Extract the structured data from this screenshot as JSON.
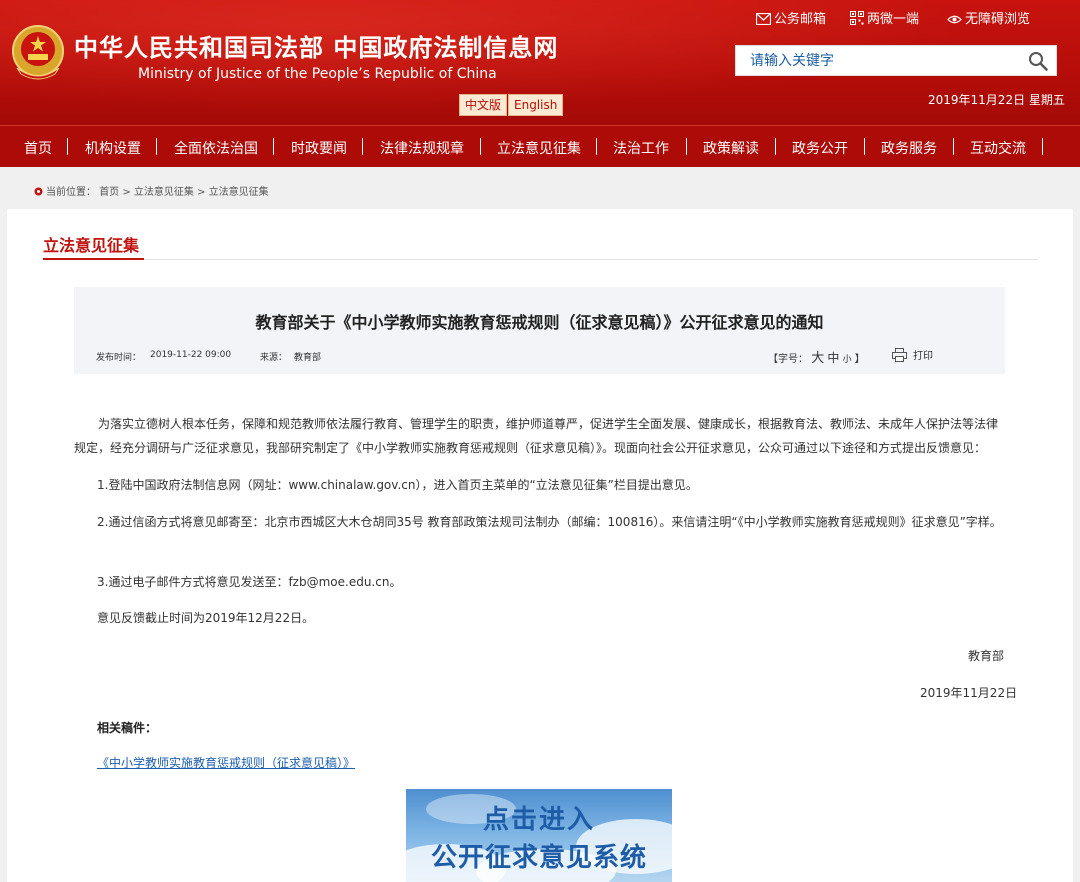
{
  "header": {
    "site_title_cn": "中华人民共和国司法部 中国政府法制信息网",
    "site_title_en": "Ministry of Justice of the People’s Republic of China",
    "lang_cn": "中文版",
    "lang_en": "English",
    "top_links": [
      "公务邮箱",
      "两微一端",
      "无障碍浏览"
    ],
    "search_placeholder": "请输入关键字",
    "date": "2019年11月22日 星期五",
    "brand_color": "#b50d09"
  },
  "nav": {
    "items": [
      "首页",
      "机构设置",
      "全面依法治国",
      "时政要闻",
      "法律法规规章",
      "立法意见征集",
      "法治工作",
      "政策解读",
      "政务公开",
      "政务服务",
      "互动交流"
    ]
  },
  "breadcrumb": {
    "label": "当前位置：",
    "path": "首页 > 立法意见征集 > 立法意见征集"
  },
  "section": {
    "title": "立法意见征集"
  },
  "article": {
    "title": "教育部关于《中小学教师实施教育惩戒规则（征求意见稿）》公开征求意见的通知",
    "publish_label": "发布时间：",
    "publish_time": "2019-11-22 09:00",
    "source_label": "来源：",
    "source": "教育部",
    "fontsize_label": "【字号：",
    "fontsize_big": "大",
    "fontsize_mid": "中",
    "fontsize_small": "小",
    "fontsize_end": "】",
    "print_label": "打印",
    "paragraphs": [
      "为落实立德树人根本任务，保障和规范教师依法履行教育、管理学生的职责，维护师道尊严，促进学生全面发展、健康成长，根据教育法、教师法、未成年人保护法等法律规定，经充分调研与广泛征求意见，我部研究制定了《中小学教师实施教育惩戒规则（征求意见稿）》。现面向社会公开征求意见，公众可通过以下途径和方式提出反馈意见：",
      "1.登陆中国政府法制信息网（网址：www.chinalaw.gov.cn），进入首页主菜单的“立法意见征集”栏目提出意见。",
      "2.通过信函方式将意见邮寄至：北京市西城区大木仓胡同35号 教育部政策法规司法制办（邮编：100816）。来信请注明“《中小学教师实施教育惩戒规则》征求意见”字样。",
      "3.通过电子邮件方式将意见发送至：fzb@moe.edu.cn。",
      "意见反馈截止时间为2019年12月22日。"
    ],
    "signature": "教育部",
    "sign_date": "2019年11月22日",
    "related_label": "相关稿件：",
    "related_link": "《中小学教师实施教育惩戒规则（征求意见稿）》"
  },
  "banner": {
    "line1": "点击进入",
    "line2": "公开征求意见系统"
  }
}
